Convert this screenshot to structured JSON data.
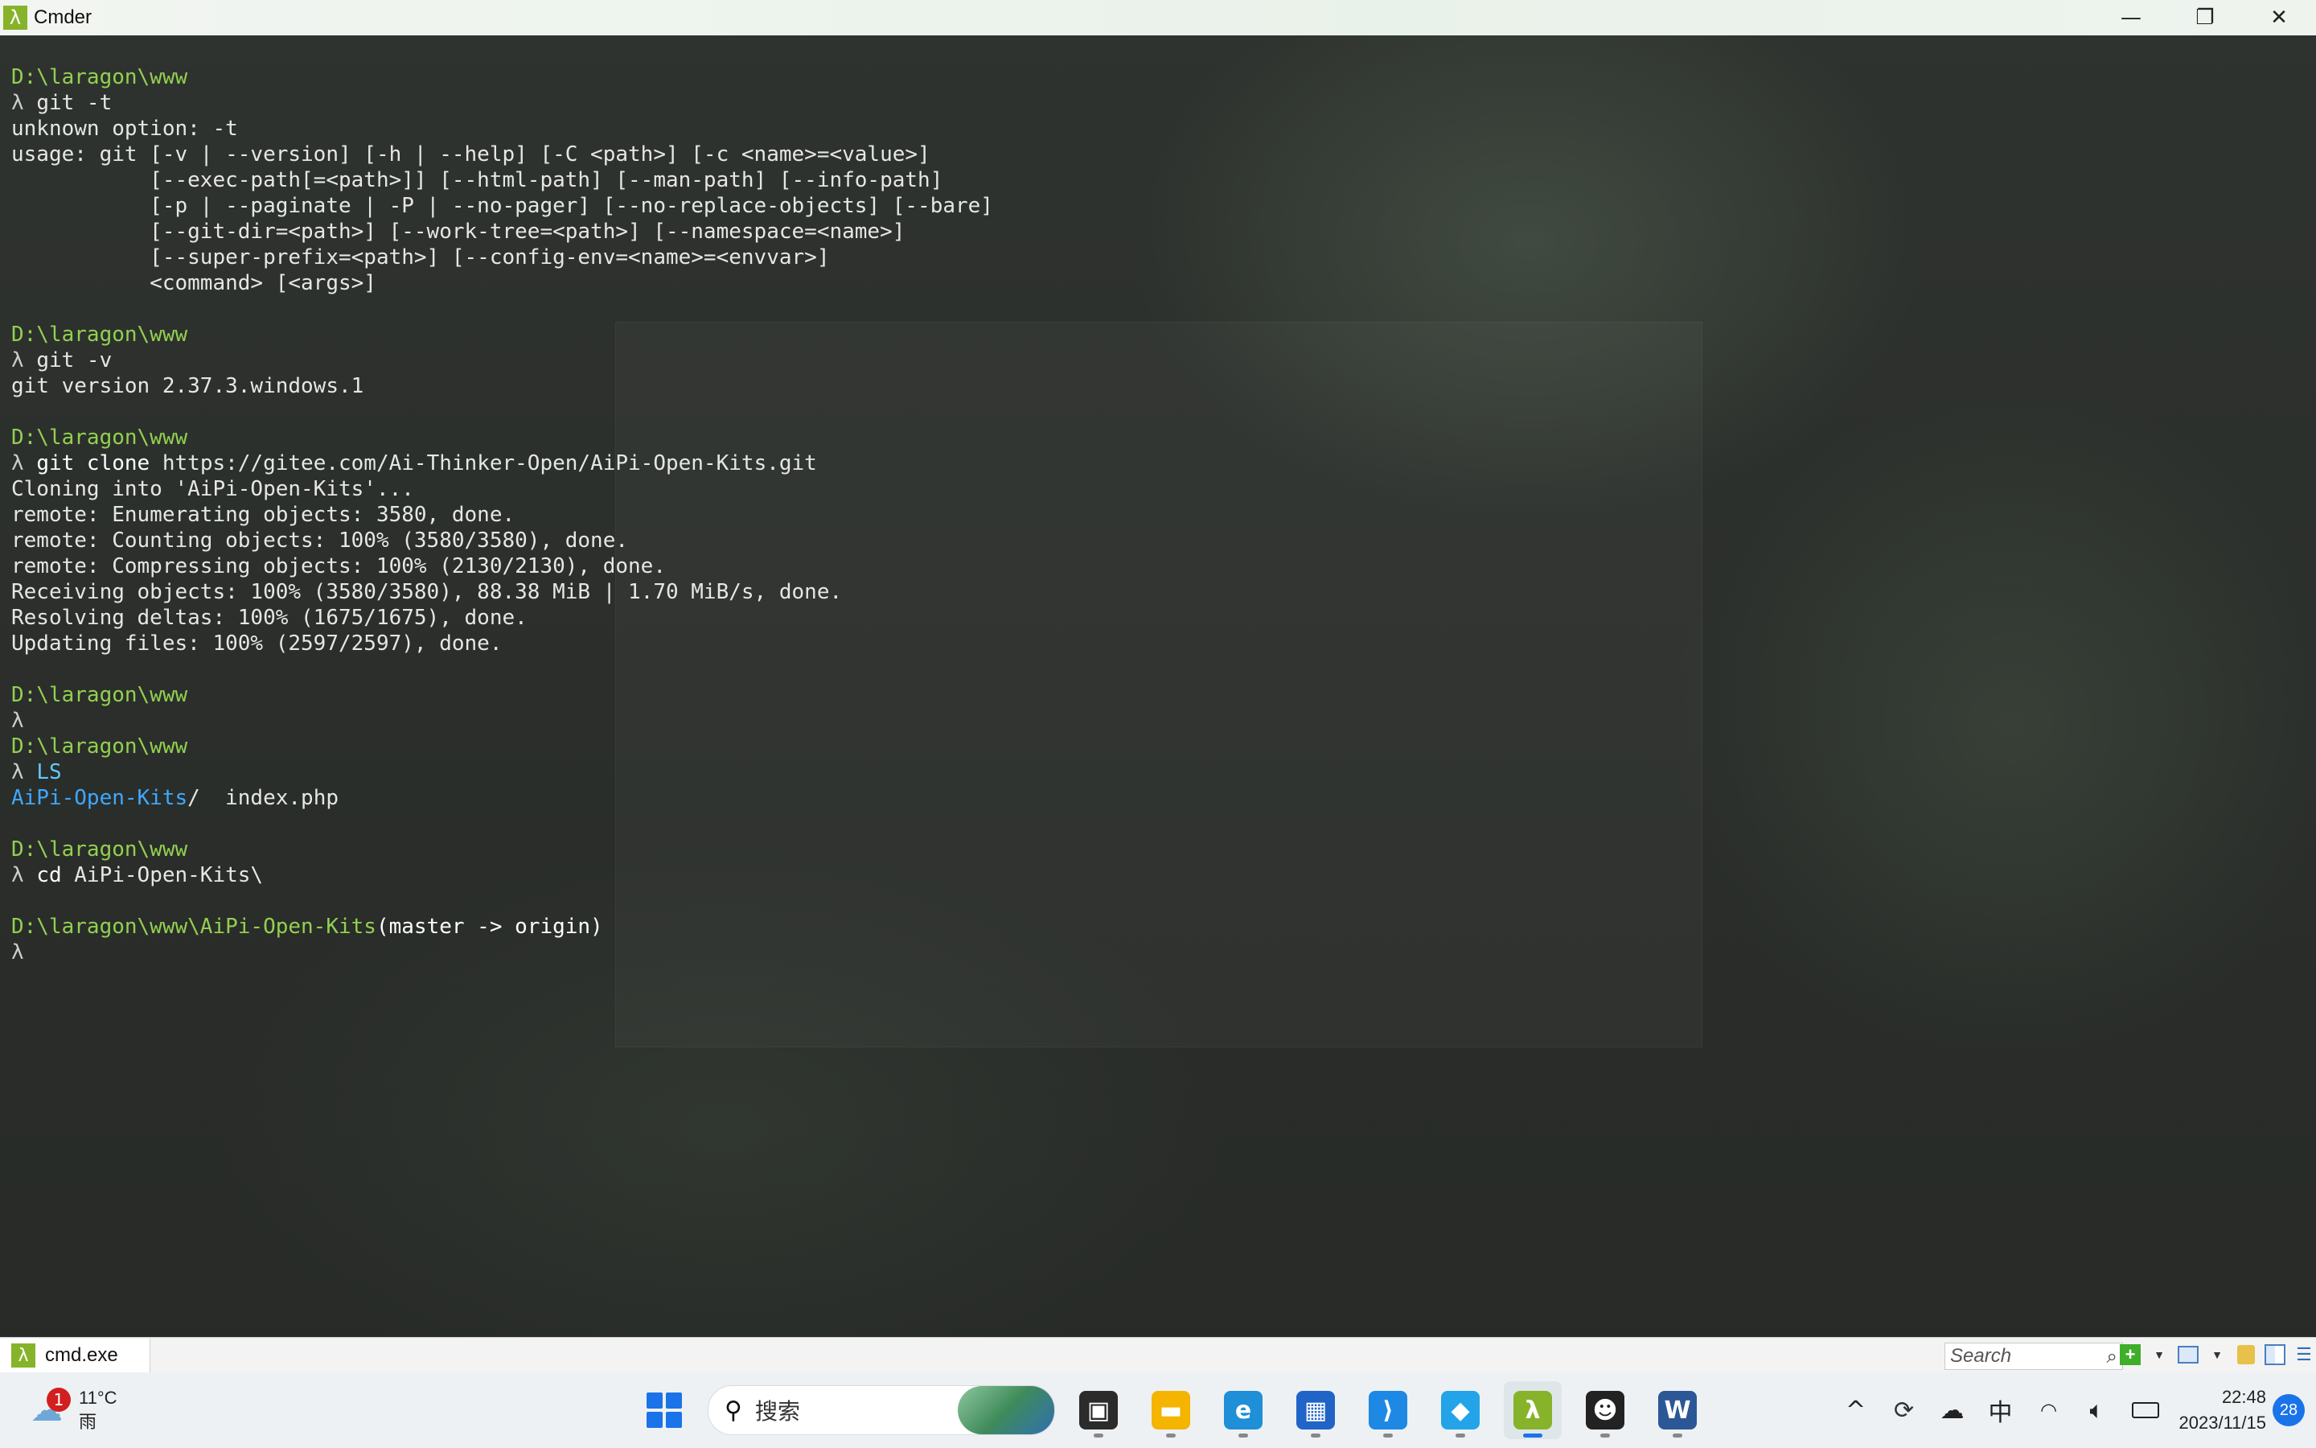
{
  "window": {
    "title": "Cmder",
    "app_icon": "λ",
    "minimize": "—",
    "restore": "❐",
    "close": "✕"
  },
  "terminal": {
    "lines": [
      {
        "segments": [
          {
            "t": "D:\\laragon\\www",
            "c": "path"
          }
        ]
      },
      {
        "segments": [
          {
            "t": "λ ",
            "c": "lambda"
          },
          {
            "t": "git -t",
            "c": "cmd"
          }
        ]
      },
      {
        "segments": [
          {
            "t": "unknown option: -t",
            "c": "cmd"
          }
        ]
      },
      {
        "segments": [
          {
            "t": "usage: git [-v | --version] [-h | --help] [-C <path>] [-c <name>=<value>]",
            "c": "cmd"
          }
        ]
      },
      {
        "segments": [
          {
            "t": "           [--exec-path[=<path>]] [--html-path] [--man-path] [--info-path]",
            "c": "cmd"
          }
        ]
      },
      {
        "segments": [
          {
            "t": "           [-p | --paginate | -P | --no-pager] [--no-replace-objects] [--bare]",
            "c": "cmd"
          }
        ]
      },
      {
        "segments": [
          {
            "t": "           [--git-dir=<path>] [--work-tree=<path>] [--namespace=<name>]",
            "c": "cmd"
          }
        ]
      },
      {
        "segments": [
          {
            "t": "           [--super-prefix=<path>] [--config-env=<name>=<envvar>]",
            "c": "cmd"
          }
        ]
      },
      {
        "segments": [
          {
            "t": "           <command> [<args>]",
            "c": "cmd"
          }
        ]
      },
      {
        "segments": []
      },
      {
        "segments": [
          {
            "t": "D:\\laragon\\www",
            "c": "path"
          }
        ]
      },
      {
        "segments": [
          {
            "t": "λ ",
            "c": "lambda"
          },
          {
            "t": "git -v",
            "c": "cmd"
          }
        ]
      },
      {
        "segments": [
          {
            "t": "git version 2.37.3.windows.1",
            "c": "cmd"
          }
        ]
      },
      {
        "segments": []
      },
      {
        "segments": [
          {
            "t": "D:\\laragon\\www",
            "c": "path"
          }
        ]
      },
      {
        "segments": [
          {
            "t": "λ ",
            "c": "lambda"
          },
          {
            "t": "git clone",
            "c": "cmd-kw"
          },
          {
            "t": " https://gitee.com/Ai-Thinker-Open/AiPi-Open-Kits.git",
            "c": "cmd"
          }
        ]
      },
      {
        "segments": [
          {
            "t": "Cloning into 'AiPi-Open-Kits'...",
            "c": "cmd"
          }
        ]
      },
      {
        "segments": [
          {
            "t": "remote: Enumerating objects: 3580, done.",
            "c": "cmd"
          }
        ]
      },
      {
        "segments": [
          {
            "t": "remote: Counting objects: 100% (3580/3580), done.",
            "c": "cmd"
          }
        ]
      },
      {
        "segments": [
          {
            "t": "remote: Compressing objects: 100% (2130/2130), done.",
            "c": "cmd"
          }
        ]
      },
      {
        "segments": [
          {
            "t": "Receiving objects: 100% (3580/3580), 88.38 MiB | 1.70 MiB/s, done.",
            "c": "cmd"
          }
        ]
      },
      {
        "segments": [
          {
            "t": "Resolving deltas: 100% (1675/1675), done.",
            "c": "cmd"
          }
        ]
      },
      {
        "segments": [
          {
            "t": "Updating files: 100% (2597/2597), done.",
            "c": "cmd"
          }
        ]
      },
      {
        "segments": []
      },
      {
        "segments": [
          {
            "t": "D:\\laragon\\www",
            "c": "path"
          }
        ]
      },
      {
        "segments": [
          {
            "t": "λ",
            "c": "lambda"
          }
        ]
      },
      {
        "segments": [
          {
            "t": "D:\\laragon\\www",
            "c": "path"
          }
        ]
      },
      {
        "segments": [
          {
            "t": "λ ",
            "c": "lambda"
          },
          {
            "t": "LS",
            "c": "cyan"
          }
        ]
      },
      {
        "segments": [
          {
            "t": "AiPi-Open-Kits",
            "c": "dir"
          },
          {
            "t": "/  index.php",
            "c": "cmd"
          }
        ]
      },
      {
        "segments": []
      },
      {
        "segments": [
          {
            "t": "D:\\laragon\\www",
            "c": "path"
          }
        ]
      },
      {
        "segments": [
          {
            "t": "λ ",
            "c": "lambda"
          },
          {
            "t": "cd",
            "c": "cmd-kw"
          },
          {
            "t": " AiPi-Open-Kits\\",
            "c": "cmd"
          }
        ]
      },
      {
        "segments": []
      },
      {
        "segments": [
          {
            "t": "D:\\laragon\\www\\AiPi-Open-Kits",
            "c": "path"
          },
          {
            "t": "(master -> origin)",
            "c": "branch"
          }
        ]
      },
      {
        "segments": [
          {
            "t": "λ",
            "c": "lambda"
          }
        ]
      }
    ]
  },
  "cmder_tabbar": {
    "tab_icon": "λ",
    "tab_label": "cmd.exe",
    "search_placeholder": "Search",
    "search_icon": "⌕"
  },
  "taskbar": {
    "weather": {
      "temp": "11°C",
      "condition": "雨",
      "alert_count": "1",
      "icon": "☁"
    },
    "search_placeholder": "搜索",
    "search_icon": "⚲",
    "apps": [
      {
        "name": "task-view",
        "glyph": "▣",
        "color": "#2b2b2b",
        "active": false
      },
      {
        "name": "file-explorer",
        "glyph": "▬",
        "color": "#f4b400",
        "active": false
      },
      {
        "name": "edge-browser",
        "glyph": "e",
        "color": "#1f8fd8",
        "active": false
      },
      {
        "name": "microsoft-store",
        "glyph": "▦",
        "color": "#2064c7",
        "active": false
      },
      {
        "name": "vscode",
        "glyph": "⟩",
        "color": "#1e88e5",
        "active": false
      },
      {
        "name": "chat-app",
        "glyph": "◆",
        "color": "#23a4e8",
        "active": false
      },
      {
        "name": "cmder",
        "glyph": "λ",
        "color": "#86b32a",
        "active": true
      },
      {
        "name": "qq",
        "glyph": "☻",
        "color": "#222222",
        "active": false
      },
      {
        "name": "word",
        "glyph": "W",
        "color": "#2b5797",
        "active": false
      }
    ],
    "tray": {
      "chevron": "^",
      "ime": "中",
      "time": "22:48",
      "date": "2023/11/15",
      "notifications": "28"
    }
  }
}
